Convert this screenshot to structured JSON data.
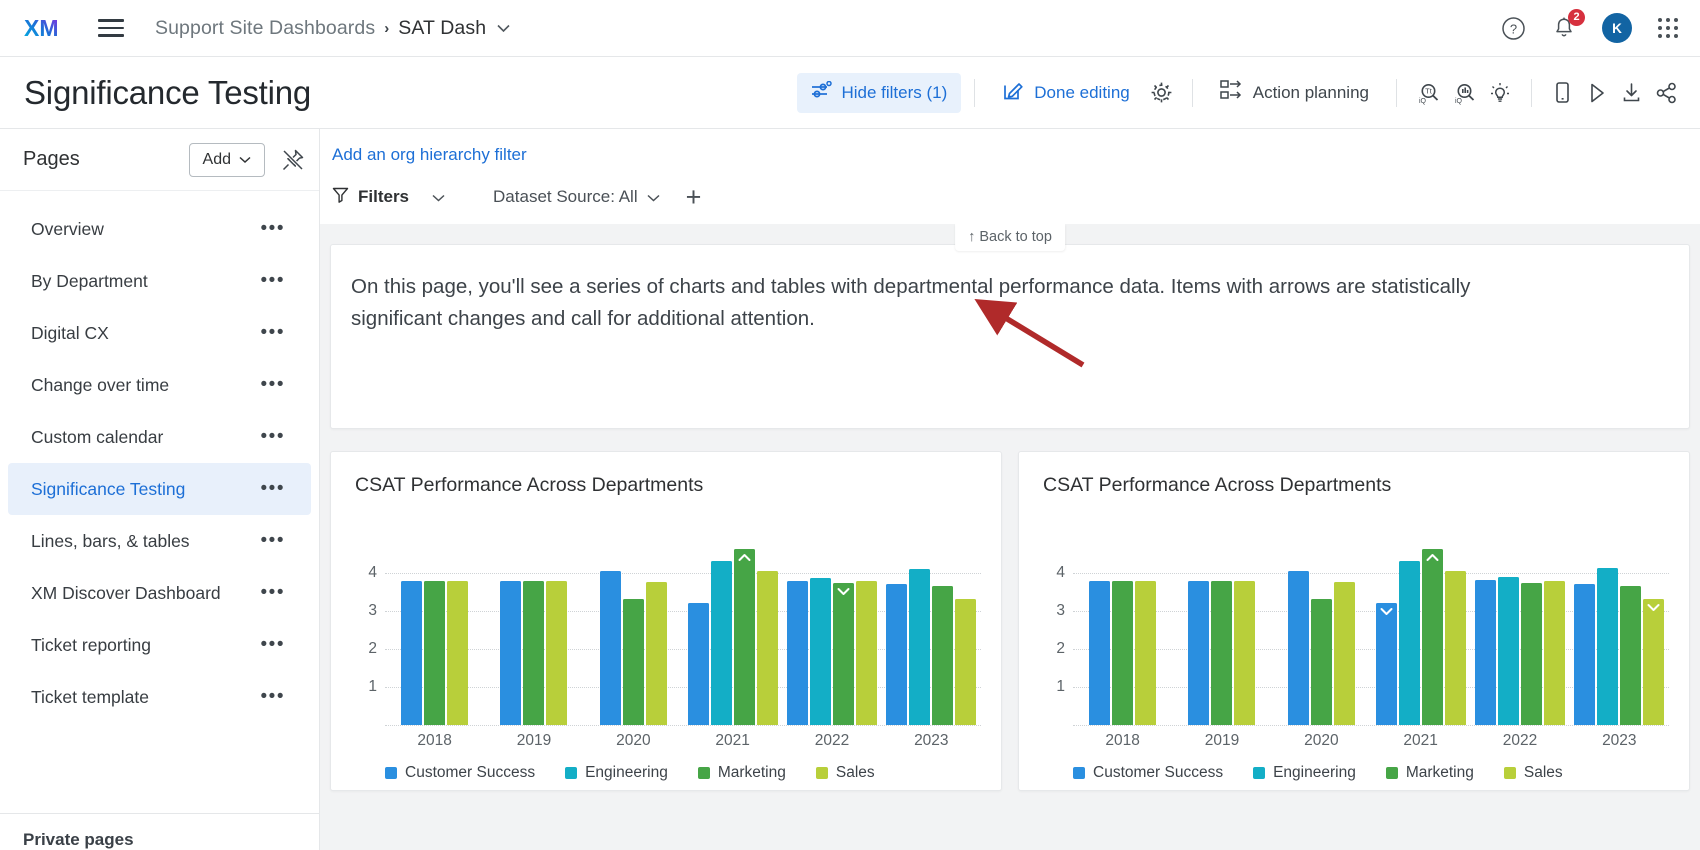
{
  "topnav": {
    "logo_text": "XM",
    "menu_icon": "hamburger-icon",
    "breadcrumb_root": "Support Site Dashboards",
    "breadcrumb_sep": "›",
    "breadcrumb_leaf": "SAT Dash",
    "breadcrumb_caret": "⌄",
    "help_icon": "question-mark-icon",
    "notifications_icon": "bell-icon",
    "notifications_count": "2",
    "avatar_initial": "K",
    "apps_icon": "app-grid-icon"
  },
  "actionbar": {
    "page_title": "Significance Testing",
    "hide_filters_label": "Hide filters (1)",
    "done_editing_label": "Done editing",
    "settings_icon": "gear-icon",
    "action_planning_label": "Action planning",
    "text_iq_icon": "text-iq-search-icon",
    "stats_iq_icon": "stats-iq-search-icon",
    "insights_icon": "lightbulb-icon",
    "mobile_icon": "mobile-preview-icon",
    "play_icon": "play-icon",
    "download_icon": "download-icon",
    "share_icon": "share-icon"
  },
  "sidebar": {
    "header_label": "Pages",
    "add_label": "Add",
    "add_caret": "⌄",
    "pin_icon": "unpin-icon",
    "overflow_glyph": "•••",
    "items": [
      {
        "label": "Overview",
        "selected": false
      },
      {
        "label": "By Department",
        "selected": false
      },
      {
        "label": "Digital CX",
        "selected": false
      },
      {
        "label": "Change over time",
        "selected": false
      },
      {
        "label": "Custom calendar",
        "selected": false
      },
      {
        "label": "Significance Testing",
        "selected": true
      },
      {
        "label": "Lines, bars, & tables",
        "selected": false
      },
      {
        "label": "XM Discover Dashboard",
        "selected": false
      },
      {
        "label": "Ticket reporting",
        "selected": false
      },
      {
        "label": "Ticket template",
        "selected": false
      }
    ],
    "private_pages_label": "Private pages"
  },
  "filterbar": {
    "org_hierarchy_link": "Add an org hierarchy filter",
    "filters_label": "Filters",
    "filters_icon": "funnel-icon",
    "filters_caret": "⌄",
    "dataset_source_label": "Dataset Source: All",
    "dataset_caret": "⌄",
    "add_filter_glyph": "+"
  },
  "canvas": {
    "back_to_top_label": "↑ Back to top",
    "text_widget_body": "On this page, you'll see a series of charts and tables with departmental performance data. Items with arrows are statistically significant changes and call for additional attention.",
    "annotation_arrow": "red-arrow-annotation"
  },
  "colors": {
    "customer_success": "#2a8fe0",
    "engineering": "#13aec6",
    "marketing": "#46a546",
    "sales": "#b8cf3a",
    "accent_blue": "#1d6fd6",
    "annotation_red": "#b02a2a"
  },
  "chart_data": [
    {
      "type": "bar",
      "title": "CSAT Performance Across Departments",
      "xlabel": "",
      "ylabel": "",
      "ylim": [
        0,
        5
      ],
      "yticks": [
        1,
        2,
        3,
        4
      ],
      "grid": true,
      "legend_position": "bottom",
      "categories": [
        "2018",
        "2019",
        "2020",
        "2021",
        "2022",
        "2023"
      ],
      "series": [
        {
          "name": "Customer Success",
          "color": "#2a8fe0",
          "values": [
            3.8,
            3.8,
            4.05,
            3.2,
            3.8,
            3.72
          ],
          "significance": [
            null,
            null,
            null,
            null,
            null,
            null
          ]
        },
        {
          "name": "Engineering",
          "color": "#13aec6",
          "values": [
            null,
            null,
            null,
            4.32,
            3.88,
            4.1
          ],
          "significance": [
            null,
            null,
            null,
            null,
            null,
            null
          ]
        },
        {
          "name": "Marketing",
          "color": "#46a546",
          "values": [
            3.8,
            3.8,
            3.32,
            4.62,
            3.74,
            3.66
          ],
          "significance": [
            null,
            null,
            null,
            "up",
            "down",
            null
          ]
        },
        {
          "name": "Sales",
          "color": "#b8cf3a",
          "values": [
            3.8,
            3.8,
            3.76,
            4.04,
            3.78,
            3.32
          ],
          "significance": [
            null,
            null,
            null,
            null,
            null,
            null
          ]
        }
      ]
    },
    {
      "type": "bar",
      "title": "CSAT Performance Across Departments",
      "xlabel": "",
      "ylabel": "",
      "ylim": [
        0,
        5
      ],
      "yticks": [
        1,
        2,
        3,
        4
      ],
      "grid": true,
      "legend_position": "bottom",
      "categories": [
        "2018",
        "2019",
        "2020",
        "2021",
        "2022",
        "2023"
      ],
      "series": [
        {
          "name": "Customer Success",
          "color": "#2a8fe0",
          "values": [
            3.8,
            3.8,
            4.05,
            3.2,
            3.82,
            3.72
          ],
          "significance": [
            null,
            null,
            null,
            "down",
            null,
            null
          ]
        },
        {
          "name": "Engineering",
          "color": "#13aec6",
          "values": [
            null,
            null,
            null,
            4.32,
            3.9,
            4.14
          ],
          "significance": [
            null,
            null,
            null,
            null,
            null,
            null
          ]
        },
        {
          "name": "Marketing",
          "color": "#46a546",
          "values": [
            3.8,
            3.8,
            3.32,
            4.62,
            3.74,
            3.66
          ],
          "significance": [
            null,
            null,
            null,
            "up",
            null,
            null
          ]
        },
        {
          "name": "Sales",
          "color": "#b8cf3a",
          "values": [
            3.8,
            3.8,
            3.76,
            4.04,
            3.78,
            3.32
          ],
          "significance": [
            null,
            null,
            null,
            null,
            null,
            "down"
          ]
        }
      ]
    }
  ]
}
